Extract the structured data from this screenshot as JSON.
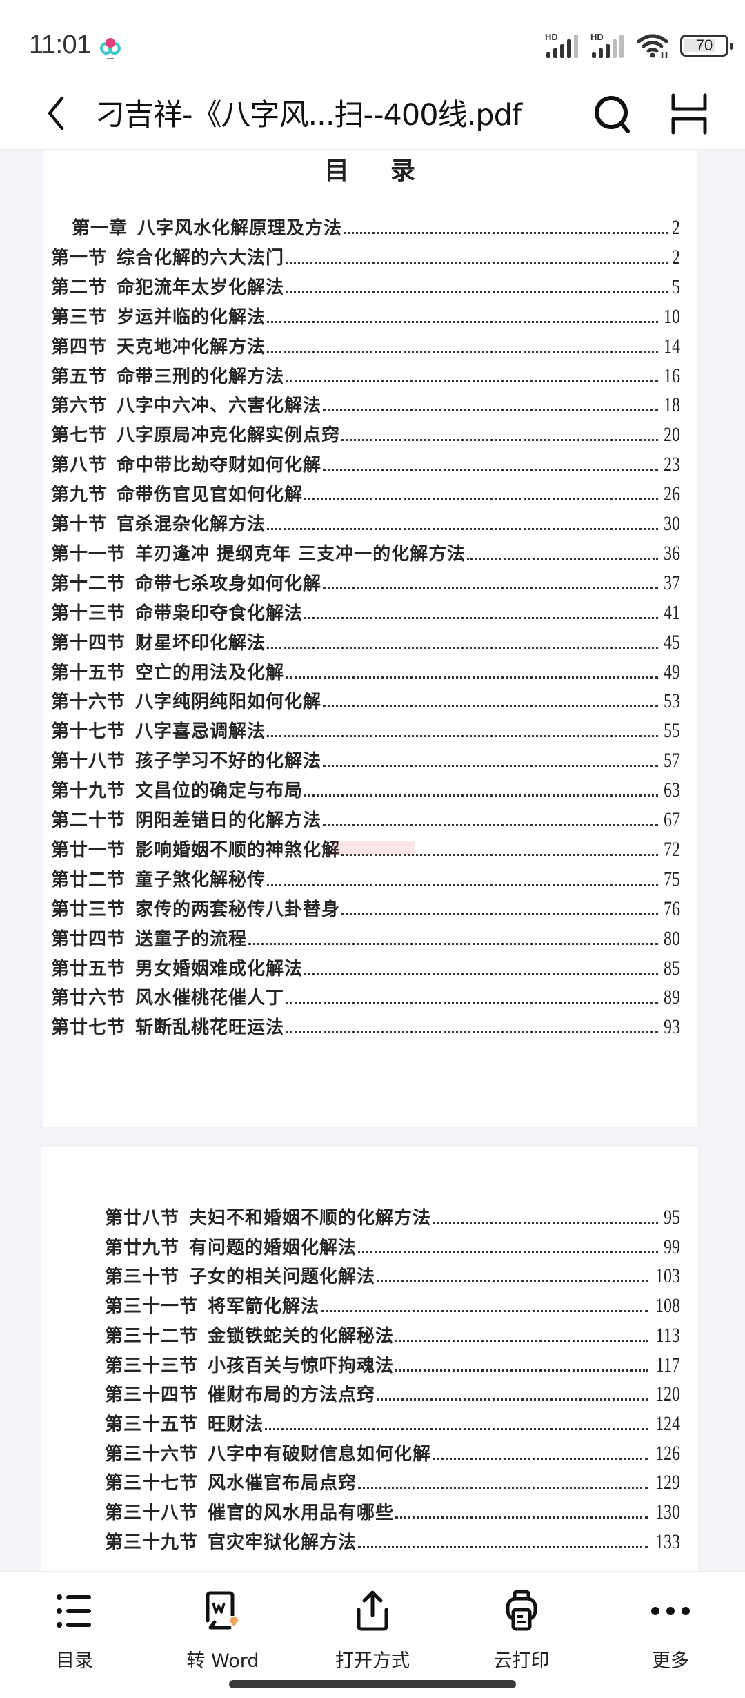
{
  "status_bar": {
    "time": "11:01",
    "battery_level": "70",
    "signal_1_label": "HD",
    "signal_2_label": "HD"
  },
  "header": {
    "title": "刁吉祥-《八字风...扫--400线.pdf",
    "back_icon": "chevron-left-icon",
    "search_icon": "search-icon",
    "menu_icon": "hamburger-icon"
  },
  "document": {
    "page1": {
      "heading": "目录",
      "entries": [
        {
          "section": "第一章",
          "title": "八字风水化解原理及方法",
          "page": "2"
        },
        {
          "section": "第一节",
          "title": "综合化解的六大法门",
          "page": "2"
        },
        {
          "section": "第二节",
          "title": "命犯流年太岁化解法",
          "page": "5"
        },
        {
          "section": "第三节",
          "title": "岁运并临的化解法",
          "page": "10"
        },
        {
          "section": "第四节",
          "title": "天克地冲化解方法",
          "page": "14"
        },
        {
          "section": "第五节",
          "title": "命带三刑的化解方法",
          "page": "16"
        },
        {
          "section": "第六节",
          "title": "八字中六冲、六害化解法",
          "page": "18"
        },
        {
          "section": "第七节",
          "title": "八字原局冲克化解实例点窍",
          "page": "20"
        },
        {
          "section": "第八节",
          "title": "命中带比劫夺财如何化解",
          "page": "23"
        },
        {
          "section": "第九节",
          "title": "命带伤官见官如何化解",
          "page": "26"
        },
        {
          "section": "第十节",
          "title": "官杀混杂化解方法",
          "page": "30"
        },
        {
          "section": "第十一节",
          "title": "羊刃逢冲 提纲克年 三支冲一的化解方法",
          "page": "36"
        },
        {
          "section": "第十二节",
          "title": "命带七杀攻身如何化解",
          "page": "37"
        },
        {
          "section": "第十三节",
          "title": "命带枭印夺食化解法",
          "page": "41"
        },
        {
          "section": "第十四节",
          "title": "财星坏印化解法",
          "page": "45"
        },
        {
          "section": "第十五节",
          "title": "空亡的用法及化解",
          "page": "49"
        },
        {
          "section": "第十六节",
          "title": "八字纯阴纯阳如何化解",
          "page": "53"
        },
        {
          "section": "第十七节",
          "title": "八字喜忌调解法",
          "page": "55"
        },
        {
          "section": "第十八节",
          "title": "孩子学习不好的化解法",
          "page": "57"
        },
        {
          "section": "第十九节",
          "title": "文昌位的确定与布局",
          "page": "63"
        },
        {
          "section": "第二十节",
          "title": "阴阳差错日的化解方法",
          "page": "67"
        },
        {
          "section": "第廿一节",
          "title": "影响婚姻不顺的神煞化解",
          "page": "72"
        },
        {
          "section": "第廿二节",
          "title": "童子煞化解秘传",
          "page": "75"
        },
        {
          "section": "第廿三节",
          "title": "家传的两套秘传八卦替身",
          "page": "76"
        },
        {
          "section": "第廿四节",
          "title": "送童子的流程",
          "page": "80"
        },
        {
          "section": "第廿五节",
          "title": "男女婚姻难成化解法",
          "page": "85"
        },
        {
          "section": "第廿六节",
          "title": "风水催桃花催人丁",
          "page": "89"
        },
        {
          "section": "第廿七节",
          "title": "斩断乱桃花旺运法",
          "page": "93"
        }
      ]
    },
    "page2": {
      "entries": [
        {
          "section": "第廿八节",
          "title": "夫妇不和婚姻不顺的化解方法",
          "page": "95"
        },
        {
          "section": "第廿九节",
          "title": "有问题的婚姻化解法",
          "page": "99"
        },
        {
          "section": "第三十节",
          "title": "子女的相关问题化解法",
          "page": "103"
        },
        {
          "section": "第三十一节",
          "title": "将军箭化解法",
          "page": "108"
        },
        {
          "section": "第三十二节",
          "title": "金锁铁蛇关的化解秘法",
          "page": "113"
        },
        {
          "section": "第三十三节",
          "title": "小孩百关与惊吓拘魂法",
          "page": "117"
        },
        {
          "section": "第三十四节",
          "title": "催财布局的方法点窍",
          "page": "120"
        },
        {
          "section": "第三十五节",
          "title": "旺财法",
          "page": "124"
        },
        {
          "section": "第三十六节",
          "title": "八字中有破财信息如何化解",
          "page": "126"
        },
        {
          "section": "第三十七节",
          "title": "风水催官布局点窍",
          "page": "129"
        },
        {
          "section": "第三十八节",
          "title": "催官的风水用品有哪些",
          "page": "130"
        },
        {
          "section": "第三十九节",
          "title": "官灾牢狱化解方法",
          "page": "133"
        }
      ]
    }
  },
  "toolbar": {
    "items": [
      {
        "label": "目录",
        "icon": "list-icon"
      },
      {
        "label": "转 Word",
        "icon": "word-convert-icon"
      },
      {
        "label": "打开方式",
        "icon": "share-icon"
      },
      {
        "label": "云打印",
        "icon": "printer-icon"
      },
      {
        "label": "更多",
        "icon": "more-icon"
      }
    ]
  },
  "colors": {
    "background": "#f4f4f8",
    "page": "#ffffff",
    "text": "#262626",
    "vip_badge": "#f0a560"
  }
}
